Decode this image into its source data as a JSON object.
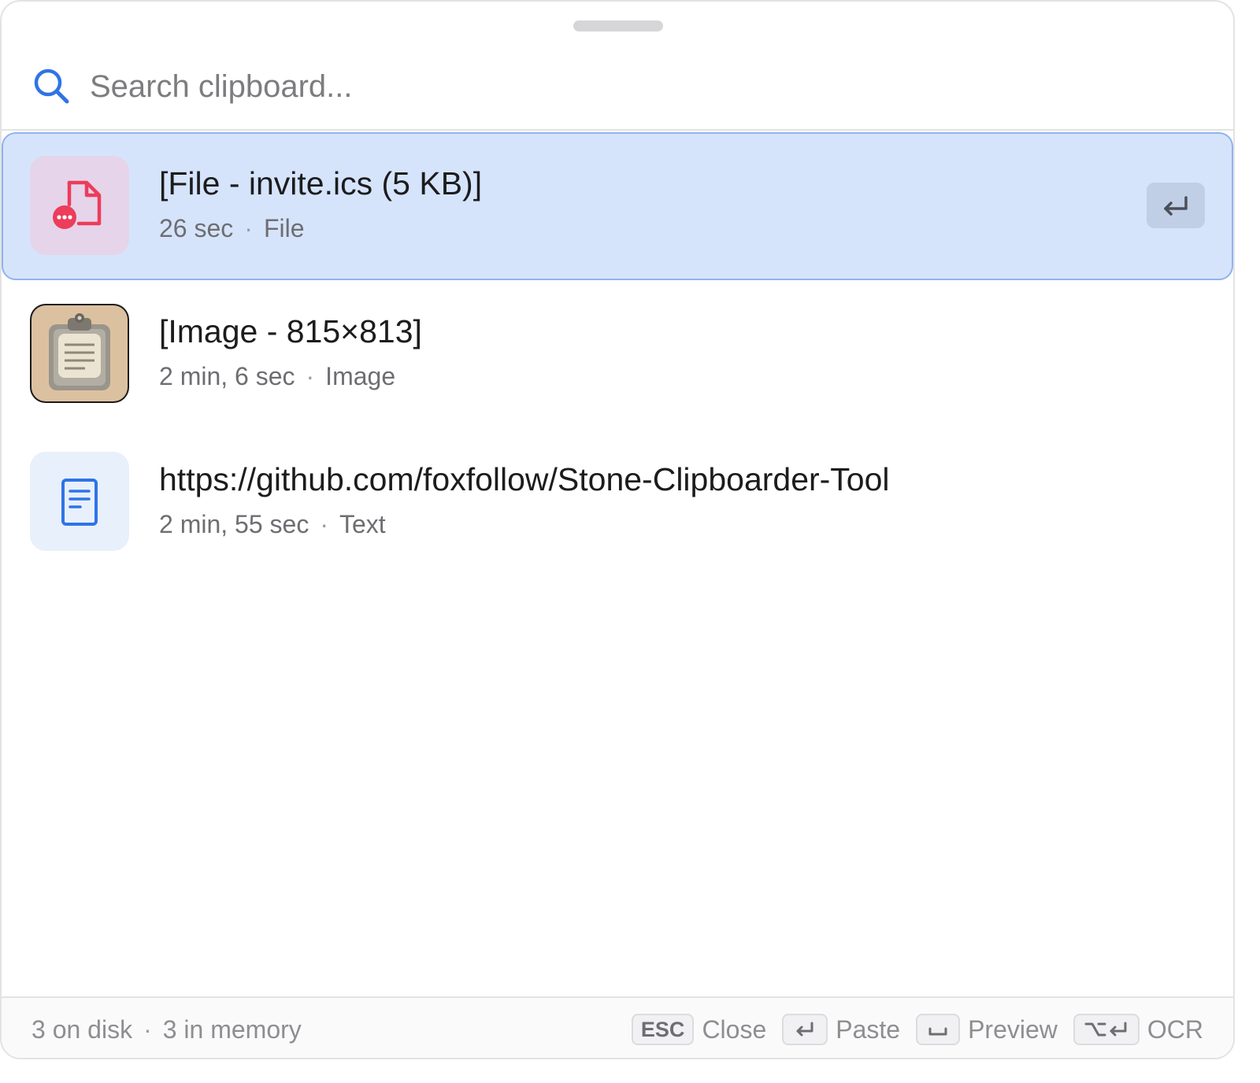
{
  "search": {
    "placeholder": "Search clipboard..."
  },
  "items": [
    {
      "title": "[File - invite.ics (5 KB)]",
      "age": "26 sec",
      "kind": "File",
      "selected": true,
      "icon": "file-icon"
    },
    {
      "title": "[Image - 815×813]",
      "age": "2 min, 6 sec",
      "kind": "Image",
      "selected": false,
      "icon": "clipboard-image-thumbnail"
    },
    {
      "title": "https://github.com/foxfollow/Stone-Clipboarder-Tool",
      "age": "2 min, 55 sec",
      "kind": "Text",
      "selected": false,
      "icon": "document-text-icon"
    }
  ],
  "footer": {
    "on_disk": "3 on disk",
    "in_memory": "3 in memory",
    "separator": "·",
    "shortcuts": [
      {
        "key": "ESC",
        "label": "Close"
      },
      {
        "key": "enter-icon",
        "label": "Paste"
      },
      {
        "key": "space-icon",
        "label": "Preview"
      },
      {
        "key": "option-enter-icon",
        "label": "OCR"
      }
    ]
  },
  "meta_separator": "·",
  "colors": {
    "accent": "#2f74e6",
    "selection": "#d6e4fb",
    "selection_border": "#8fb3ef",
    "file_icon": "#ec3d5a"
  }
}
